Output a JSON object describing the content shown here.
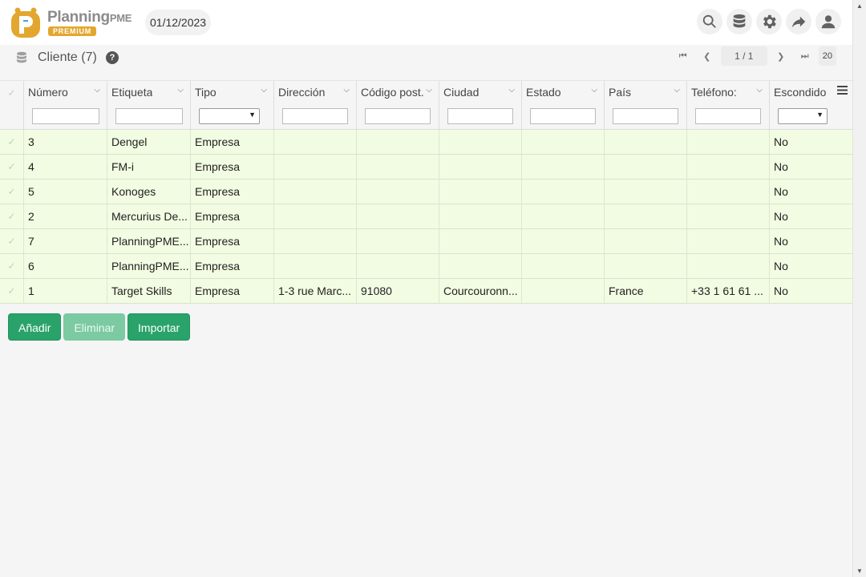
{
  "header": {
    "logo_text": "Planning",
    "logo_text_suffix": "PME",
    "logo_badge": "PREMIUM",
    "date": "01/12/2023",
    "icons": [
      "search-icon",
      "database-icon",
      "gear-icon",
      "share-icon",
      "user-icon"
    ]
  },
  "subheader": {
    "title": "Cliente (7)",
    "help": "?",
    "pager": {
      "page": "1 / 1",
      "page_size": "20"
    }
  },
  "grid": {
    "columns": [
      "Número",
      "Etiqueta",
      "Tipo",
      "Dirección",
      "Código post.",
      "Ciudad",
      "Estado",
      "País",
      "Teléfono:",
      "Escondido"
    ],
    "rows": [
      [
        "3",
        "Dengel",
        "Empresa",
        "",
        "",
        "",
        "",
        "",
        "",
        "No"
      ],
      [
        "4",
        "FM-i",
        "Empresa",
        "",
        "",
        "",
        "",
        "",
        "",
        "No"
      ],
      [
        "5",
        "Konoges",
        "Empresa",
        "",
        "",
        "",
        "",
        "",
        "",
        "No"
      ],
      [
        "2",
        "Mercurius De...",
        "Empresa",
        "",
        "",
        "",
        "",
        "",
        "",
        "No"
      ],
      [
        "7",
        "PlanningPME...",
        "Empresa",
        "",
        "",
        "",
        "",
        "",
        "",
        "No"
      ],
      [
        "6",
        "PlanningPME...",
        "Empresa",
        "",
        "",
        "",
        "",
        "",
        "",
        "No"
      ],
      [
        "1",
        "Target Skills",
        "Empresa",
        "1-3 rue Marc...",
        "91080",
        "Courcouronn...",
        "",
        "France",
        "+33 1 61 61 ...",
        "No"
      ]
    ]
  },
  "actions": {
    "add": "Añadir",
    "delete": "Eliminar",
    "import": "Importar"
  },
  "colors": {
    "accent": "#2aa36a",
    "row_bg": "#f2fce2",
    "logo": "#e3a72f"
  }
}
